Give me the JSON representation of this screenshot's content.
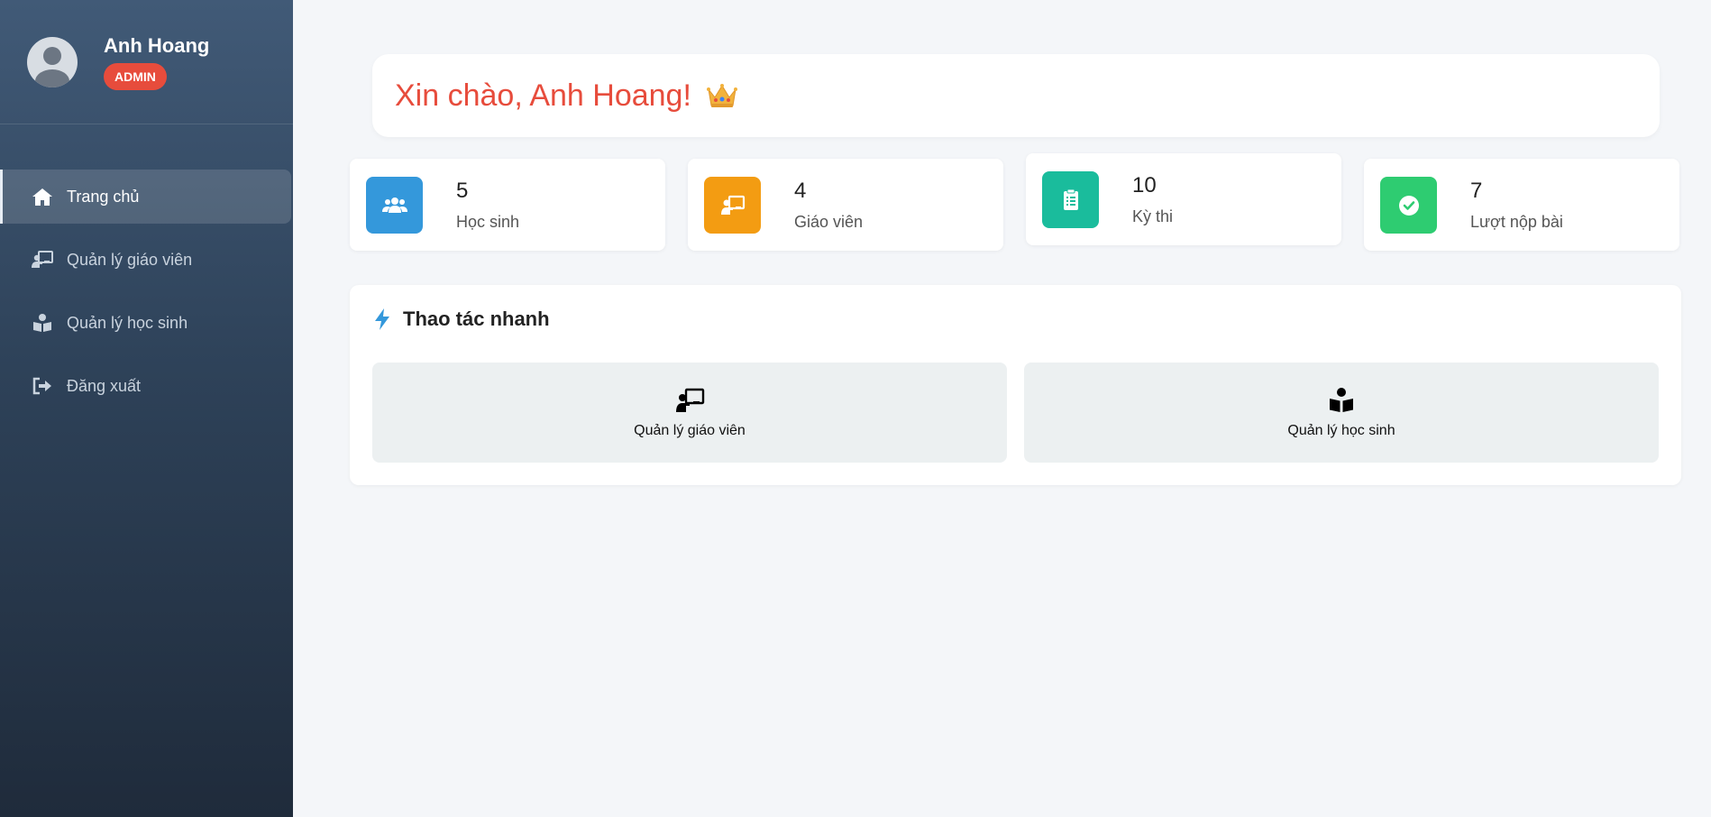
{
  "user": {
    "name": "Anh Hoang",
    "role": "ADMIN"
  },
  "nav": {
    "items": [
      {
        "label": "Trang chủ",
        "icon": "home-icon",
        "active": true
      },
      {
        "label": "Quản lý giáo viên",
        "icon": "chalkboard-teacher-icon"
      },
      {
        "label": "Quản lý học sinh",
        "icon": "reader-icon"
      },
      {
        "label": "Đăng xuất",
        "icon": "sign-out-icon"
      }
    ]
  },
  "welcome": {
    "text": "Xin chào, Anh Hoang!",
    "icon": "crown-icon"
  },
  "stats": [
    {
      "value": "5",
      "label": "Học sinh",
      "icon": "users-icon",
      "color": "#3498db"
    },
    {
      "value": "4",
      "label": "Giáo viên",
      "icon": "chalkboard-teacher-icon",
      "color": "#f39c12"
    },
    {
      "value": "10",
      "label": "Kỳ thi",
      "icon": "clipboard-list-icon",
      "color": "#1abc9c"
    },
    {
      "value": "7",
      "label": "Lượt nộp bài",
      "icon": "check-circle-icon",
      "color": "#2ecc71"
    }
  ],
  "quick_actions": {
    "title": "Thao tác nhanh",
    "icon": "bolt-icon",
    "items": [
      {
        "label": "Quản lý giáo viên",
        "icon": "chalkboard-teacher-icon"
      },
      {
        "label": "Quản lý học sinh",
        "icon": "reader-icon"
      }
    ]
  },
  "colors": {
    "accent": "#e74c3c",
    "bolt": "#3498db"
  }
}
